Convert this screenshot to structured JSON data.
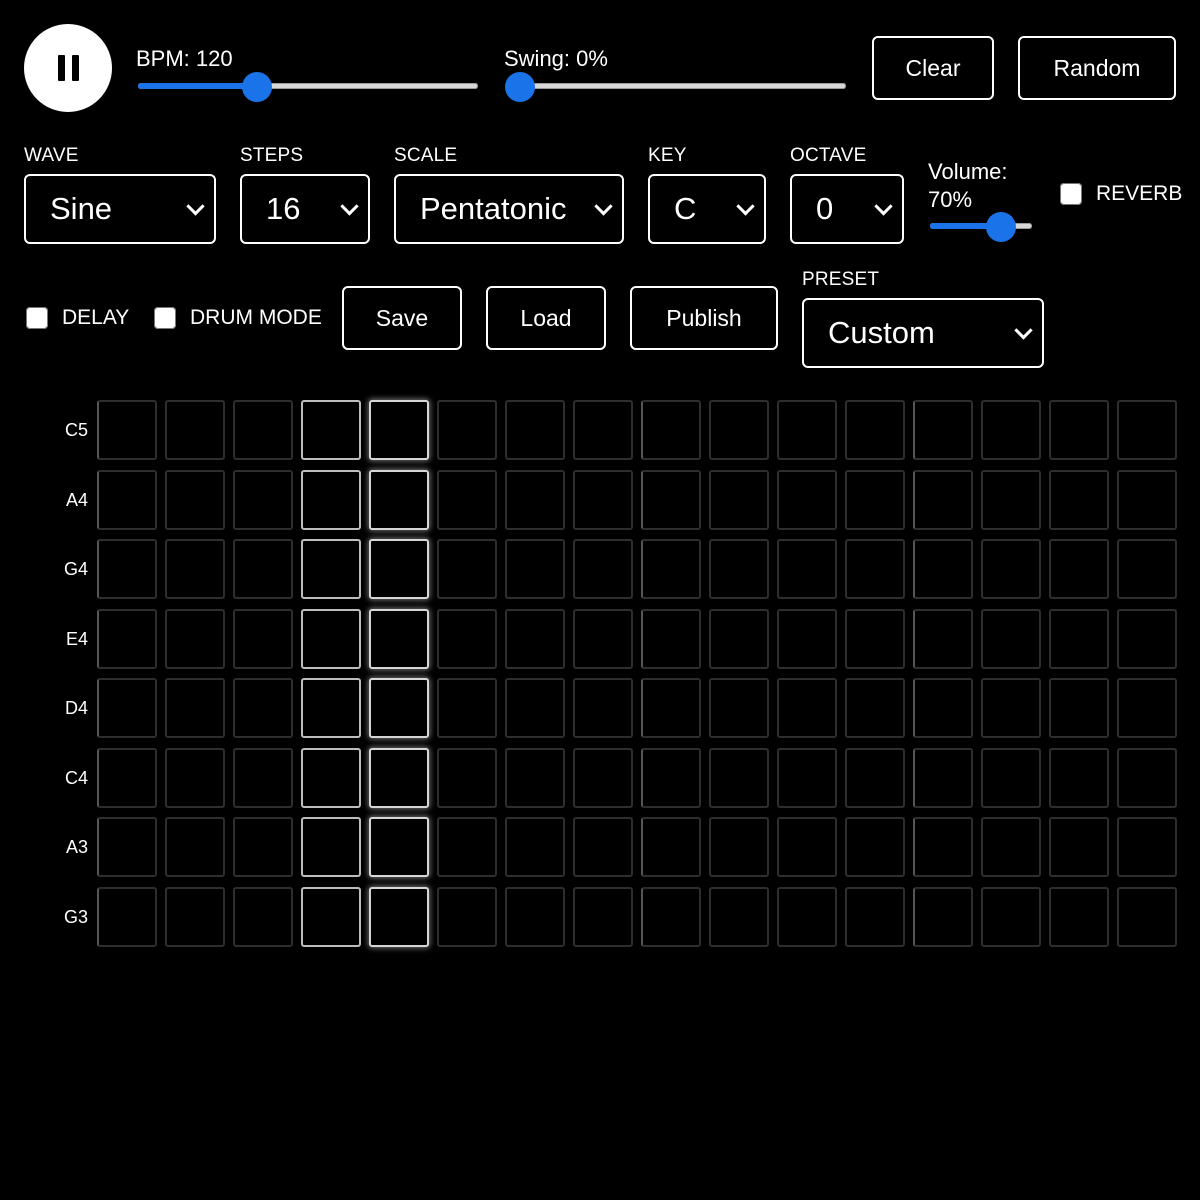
{
  "transport": {
    "play_state": "playing",
    "bpm_label": "BPM: 120",
    "bpm_value": 120,
    "bpm_fraction": 0.35,
    "swing_label": "Swing: 0%",
    "swing_percent": 0
  },
  "buttons": {
    "clear": "Clear",
    "random": "Random",
    "save": "Save",
    "load": "Load",
    "publish": "Publish"
  },
  "wave": {
    "label": "WAVE",
    "value": "Sine"
  },
  "steps": {
    "label": "STEPS",
    "value": "16"
  },
  "scale": {
    "label": "SCALE",
    "value": "Pentatonic"
  },
  "key": {
    "label": "KEY",
    "value": "C"
  },
  "octave": {
    "label": "OCTAVE",
    "value": "0"
  },
  "volume": {
    "label_line1": "Volume:",
    "label_line2": "70%",
    "percent": 70
  },
  "reverb": {
    "label": "REVERB",
    "checked": false
  },
  "delay": {
    "label": "DELAY",
    "checked": false
  },
  "drum_mode": {
    "label": "DRUM MODE",
    "checked": false
  },
  "preset": {
    "label": "PRESET",
    "value": "Custom"
  },
  "grid": {
    "rows": [
      "C5",
      "A4",
      "G4",
      "E4",
      "D4",
      "C4",
      "A3",
      "G3"
    ],
    "step_count": 16,
    "highlighted_step": 3,
    "playhead_step": 4
  },
  "colors": {
    "accent": "#1a73e8",
    "background": "#000000",
    "foreground": "#ffffff"
  }
}
